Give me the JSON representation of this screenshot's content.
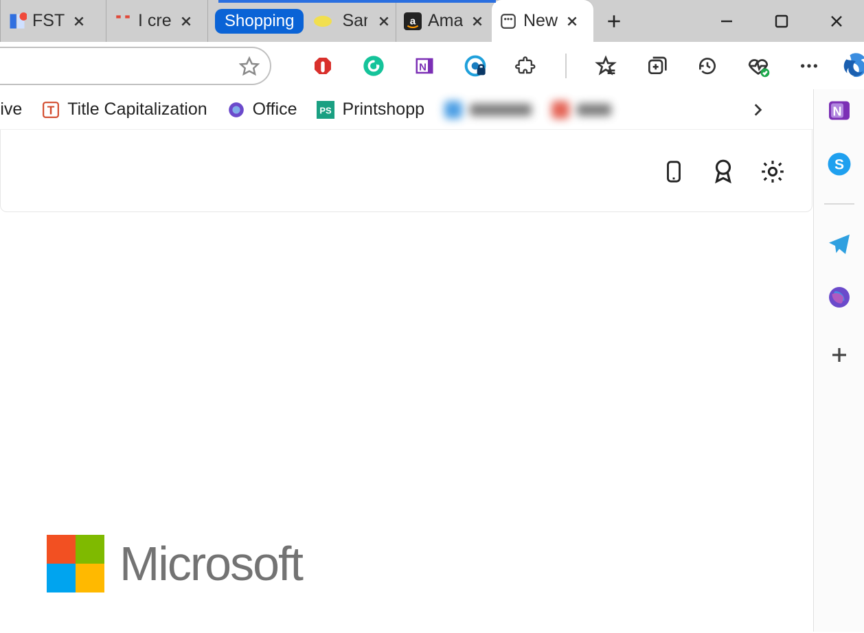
{
  "tabs": [
    {
      "label": "FST "
    },
    {
      "label": "I cre"
    },
    {
      "shopping_label": "Shopping",
      "label": "Sam"
    },
    {
      "label": "Ama"
    },
    {
      "label": "New"
    }
  ],
  "bookmarks": {
    "drive": "rive",
    "title_cap": "Title Capitalization",
    "office": "Office",
    "printshop": "Printshopp"
  },
  "logo_text": "Microsoft",
  "colors": {
    "ms_red": "#f25022",
    "ms_green": "#7fba00",
    "ms_blue": "#00a4ef",
    "ms_yellow": "#ffb900"
  }
}
